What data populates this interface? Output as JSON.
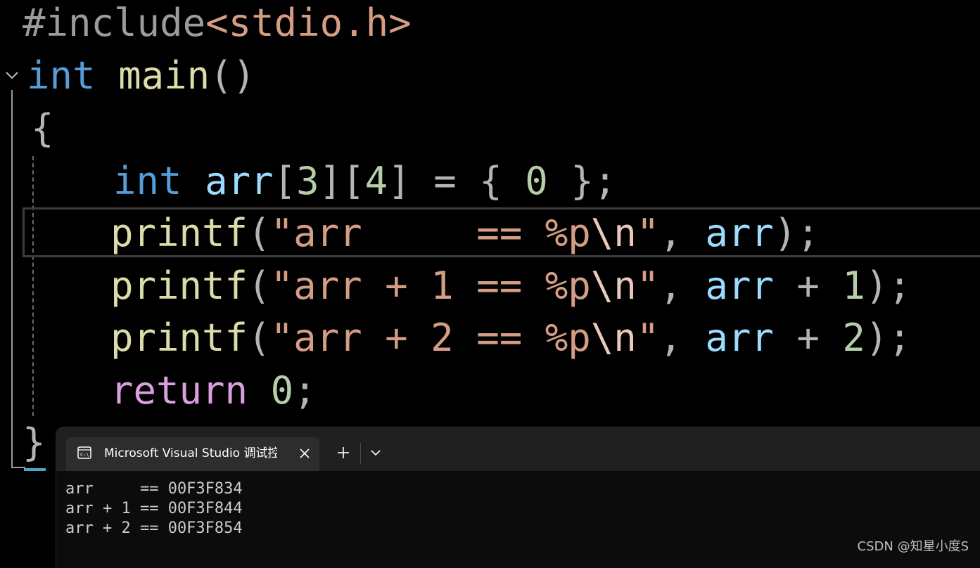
{
  "editor": {
    "lines": [
      {
        "tokens": [
          {
            "t": "#include",
            "c": "c-pre"
          },
          {
            "t": "<stdio.h>",
            "c": "c-inc"
          }
        ]
      },
      {
        "tokens": [
          {
            "t": "int",
            "c": "c-kw"
          },
          {
            "t": " ",
            "c": "c-punc"
          },
          {
            "t": "main",
            "c": "c-fn"
          },
          {
            "t": "()",
            "c": "c-punc"
          }
        ]
      },
      {
        "tokens": [
          {
            "t": "{",
            "c": "c-punc"
          }
        ]
      },
      {
        "tokens": [
          {
            "t": "int",
            "c": "c-kw"
          },
          {
            "t": " ",
            "c": "c-punc"
          },
          {
            "t": "arr",
            "c": "c-var"
          },
          {
            "t": "[",
            "c": "c-punc"
          },
          {
            "t": "3",
            "c": "c-num"
          },
          {
            "t": "][",
            "c": "c-punc"
          },
          {
            "t": "4",
            "c": "c-num"
          },
          {
            "t": "] = { ",
            "c": "c-punc"
          },
          {
            "t": "0",
            "c": "c-num"
          },
          {
            "t": " };",
            "c": "c-punc"
          }
        ]
      },
      {
        "tokens": [
          {
            "t": "printf",
            "c": "c-fn"
          },
          {
            "t": "(",
            "c": "c-punc"
          },
          {
            "t": "\"arr     == %p",
            "c": "c-str"
          },
          {
            "t": "\\n",
            "c": "c-esc"
          },
          {
            "t": "\"",
            "c": "c-str"
          },
          {
            "t": ", ",
            "c": "c-punc"
          },
          {
            "t": "arr",
            "c": "c-var"
          },
          {
            "t": ");",
            "c": "c-punc"
          }
        ]
      },
      {
        "tokens": [
          {
            "t": "printf",
            "c": "c-fn"
          },
          {
            "t": "(",
            "c": "c-punc"
          },
          {
            "t": "\"arr + 1 == %p",
            "c": "c-str"
          },
          {
            "t": "\\n",
            "c": "c-esc"
          },
          {
            "t": "\"",
            "c": "c-str"
          },
          {
            "t": ", ",
            "c": "c-punc"
          },
          {
            "t": "arr",
            "c": "c-var"
          },
          {
            "t": " + ",
            "c": "c-op"
          },
          {
            "t": "1",
            "c": "c-num"
          },
          {
            "t": ");",
            "c": "c-punc"
          }
        ]
      },
      {
        "tokens": [
          {
            "t": "printf",
            "c": "c-fn"
          },
          {
            "t": "(",
            "c": "c-punc"
          },
          {
            "t": "\"arr + 2 == %p",
            "c": "c-str"
          },
          {
            "t": "\\n",
            "c": "c-esc"
          },
          {
            "t": "\"",
            "c": "c-str"
          },
          {
            "t": ", ",
            "c": "c-punc"
          },
          {
            "t": "arr",
            "c": "c-var"
          },
          {
            "t": " + ",
            "c": "c-op"
          },
          {
            "t": "2",
            "c": "c-num"
          },
          {
            "t": ");",
            "c": "c-punc"
          }
        ]
      },
      {
        "tokens": [
          {
            "t": "return",
            "c": "c-ret"
          },
          {
            "t": " ",
            "c": "c-punc"
          },
          {
            "t": "0",
            "c": "c-num"
          },
          {
            "t": ";",
            "c": "c-punc"
          }
        ]
      },
      {
        "tokens": [
          {
            "t": "}",
            "c": "c-punc"
          }
        ]
      }
    ]
  },
  "console": {
    "tab_title": "Microsoft Visual Studio 调试控制台",
    "new_tab_symbol": "+",
    "output": [
      "arr     == 00F3F834",
      "arr + 1 == 00F3F844",
      "arr + 2 == 00F3F854"
    ]
  },
  "watermark": "CSDN @知星小度S",
  "colors": {
    "keyword": "#569cd6",
    "function": "#dcdcaa",
    "variable": "#9cdcfe",
    "string": "#d69d85",
    "number": "#b5cea8",
    "control": "#d8a0df",
    "console_bg": "#0c0c0c",
    "titlebar_bg": "#202020"
  }
}
